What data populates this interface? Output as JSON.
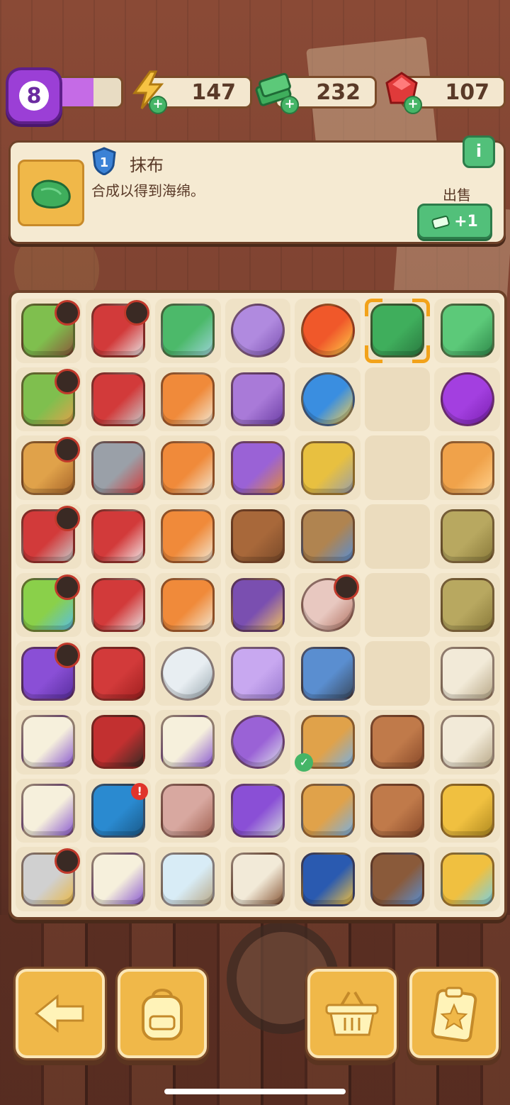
{
  "top_bar": {
    "level": "8",
    "xp_progress": 0.58,
    "energy": "147",
    "cash": "232",
    "gems": "107"
  },
  "info_panel": {
    "item_level": "1",
    "item_name": "抹布",
    "description": "合成以得到海绵。",
    "info_button": "i",
    "sell_label": "出售",
    "sell_value": "+1"
  },
  "board": {
    "rows": [
      [
        "plant-pot",
        "toolbox-red",
        "brush-green",
        "yarn-ball",
        "energy-orb-orange",
        "rag-green",
        "cash-stack"
      ],
      [
        "seed-pot",
        "pruning-shears",
        "road-barrier",
        "knitting-cloth",
        "energy-orb-blue",
        "",
        "purple-star-slime"
      ],
      [
        "treasure-crate",
        "hatchet",
        "road-barrier",
        "purple-sweater",
        "danger-sign",
        "",
        "amber-gem"
      ],
      [
        "tool-chest",
        "work-gloves",
        "road-barrier",
        "leather-coat",
        "log-saw",
        "",
        "seed-packets"
      ],
      [
        "water-box",
        "red-tray",
        "road-barrier",
        "purple-moth",
        "clay-jar",
        "",
        "seed-packet"
      ],
      [
        "purple-car",
        "red-toolbox",
        "light-bulb",
        "small-moth",
        "magnifier-small",
        "",
        "stone-block"
      ],
      [
        "dandelion-clock",
        "red-case",
        "street-lamp",
        "bulb-box",
        "magnifier",
        "broken-pot",
        "stone-bench"
      ],
      [
        "dandelion-clock",
        "blue-chest",
        "clay-vase",
        "purple-scooter",
        "fingerprint-magnifier",
        "pot-shard",
        "yellow-bucket-handle"
      ],
      [
        "crime-box",
        "dandelion-clock",
        "paper-stack",
        "footprint-card",
        "sunglasses",
        "stump-lever",
        "water-bucket"
      ]
    ],
    "timer_cells": [
      "0-0",
      "0-1",
      "1-0",
      "2-0",
      "3-0",
      "4-0",
      "4-4",
      "5-0",
      "8-0"
    ],
    "selected_cell": "0-5",
    "alert_cell": "7-1",
    "alert_text": "!",
    "check_cell": "6-4"
  },
  "bottom_buttons": [
    "back-arrow-icon",
    "backpack-icon",
    "basket-icon",
    "clipboard-star-icon"
  ],
  "colors": {
    "panel": "#f5ead2",
    "border": "#6d4128",
    "accent_green": "#52c07a",
    "button_yellow": "#f0b849",
    "level_purple": "#9b3fd6"
  }
}
